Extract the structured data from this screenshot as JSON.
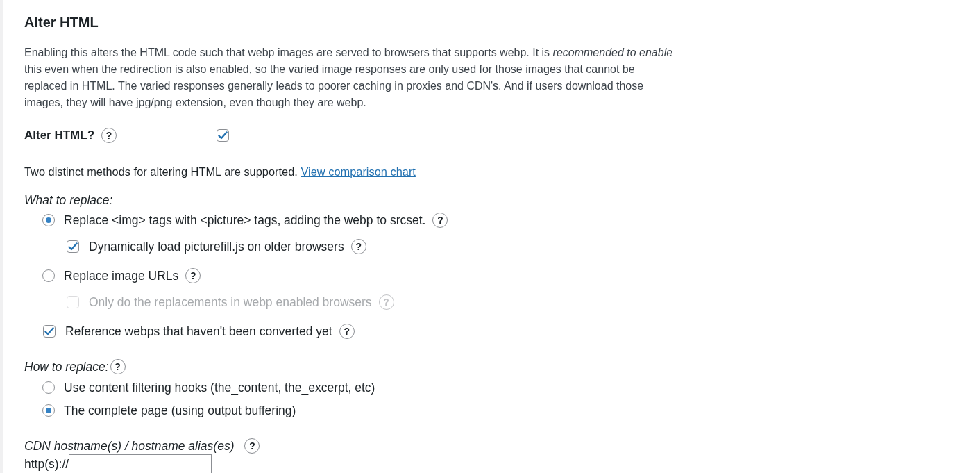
{
  "section": {
    "title": "Alter HTML",
    "description": "Enabling this alters the HTML code such that webp images are served to browsers that supports webp. It is *recommended to enable* this even when the redirection is also enabled, so the varied image responses are only used for those images that cannot be replaced in HTML. The varied responses generally leads to poorer caching in proxies and CDN's. And if users download those images, they will have jpg/png extension, even though they are webp."
  },
  "alter_html": {
    "label": "Alter HTML?",
    "help": "?",
    "checked": true
  },
  "intro": {
    "text": "Two distinct methods for altering HTML are supported.",
    "link": "View comparison chart"
  },
  "what_to_replace": {
    "label": "What to replace:",
    "methods": [
      {
        "label": "Replace <img> tags with <picture> tags, adding the webp to srcset.",
        "help": "?",
        "selected": true,
        "options": [
          {
            "label": "Dynamically load picturefill.js on older browsers",
            "help": "?",
            "checked": true,
            "disabled": false
          }
        ]
      },
      {
        "label": "Replace image URLs",
        "help": "?",
        "selected": false,
        "options": [
          {
            "label": "Only do the replacements in webp enabled browsers",
            "help": "?",
            "checked": false,
            "disabled": true
          }
        ]
      }
    ],
    "reference_unconverted": {
      "label": "Reference webps that haven't been converted yet",
      "help": "?",
      "checked": true
    }
  },
  "how_to_replace": {
    "label": "How to replace:",
    "help": "?",
    "methods": [
      {
        "label": "Use content filtering hooks (the_content, the_excerpt, etc)",
        "selected": false
      },
      {
        "label": "The complete page (using output buffering)",
        "selected": true
      }
    ]
  },
  "cdn": {
    "label": "CDN hostname(s) / hostname alias(es)",
    "help": "?",
    "prefix": "http(s)://"
  }
}
